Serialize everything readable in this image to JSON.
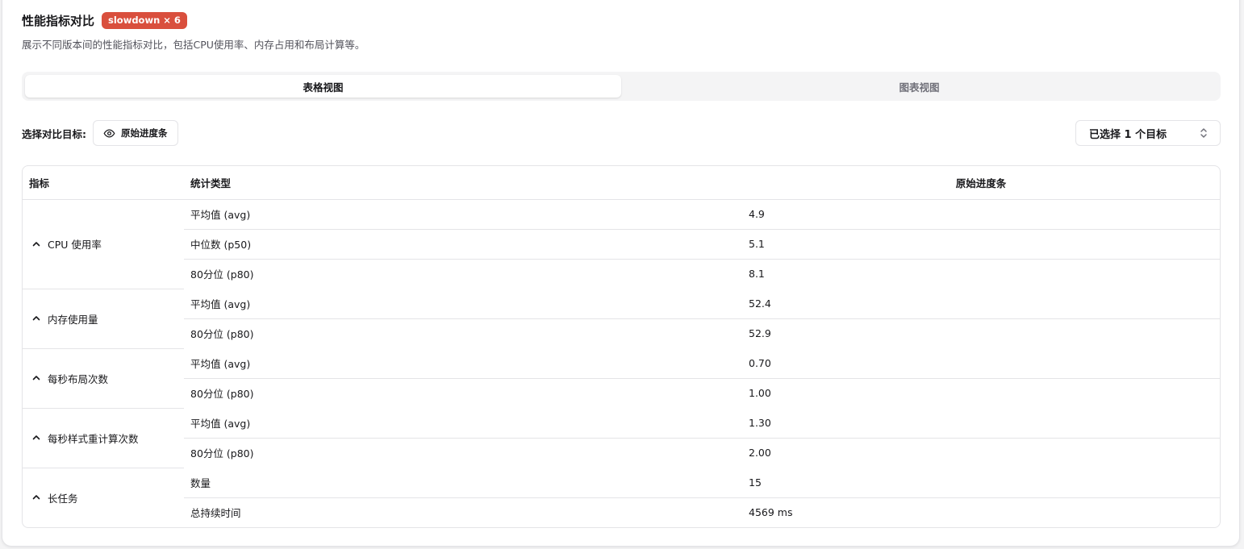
{
  "header": {
    "title": "性能指标对比",
    "badge": "slowdown × 6",
    "description": "展示不同版本间的性能指标对比，包括CPU使用率、内存占用和布局计算等。"
  },
  "tabs": [
    {
      "label": "表格视图",
      "active": true
    },
    {
      "label": "图表视图",
      "active": false
    }
  ],
  "target": {
    "label": "选择对比目标:",
    "chip_label": "原始进度条",
    "chip_icon": "eye-icon",
    "select_value": "已选择 1 个目标",
    "select_icon": "chevron-up-down-icon"
  },
  "table": {
    "columns": [
      "指标",
      "统计类型",
      "原始进度条"
    ],
    "groups": [
      {
        "name": "CPU 使用率",
        "rows": [
          {
            "stat": "平均值 (avg)",
            "value": "4.9"
          },
          {
            "stat": "中位数 (p50)",
            "value": "5.1"
          },
          {
            "stat": "80分位 (p80)",
            "value": "8.1"
          }
        ]
      },
      {
        "name": "内存使用量",
        "rows": [
          {
            "stat": "平均值 (avg)",
            "value": "52.4"
          },
          {
            "stat": "80分位 (p80)",
            "value": "52.9"
          }
        ]
      },
      {
        "name": "每秒布局次数",
        "rows": [
          {
            "stat": "平均值 (avg)",
            "value": "0.70"
          },
          {
            "stat": "80分位 (p80)",
            "value": "1.00"
          }
        ]
      },
      {
        "name": "每秒样式重计算次数",
        "rows": [
          {
            "stat": "平均值 (avg)",
            "value": "1.30"
          },
          {
            "stat": "80分位 (p80)",
            "value": "2.00"
          }
        ]
      },
      {
        "name": "长任务",
        "rows": [
          {
            "stat": "数量",
            "value": "15"
          },
          {
            "stat": "总持续时间",
            "value": "4569 ms"
          }
        ]
      }
    ]
  },
  "colors": {
    "badge": "#d94f3d",
    "border": "#e4e4e7",
    "muted_text": "#71717a"
  }
}
